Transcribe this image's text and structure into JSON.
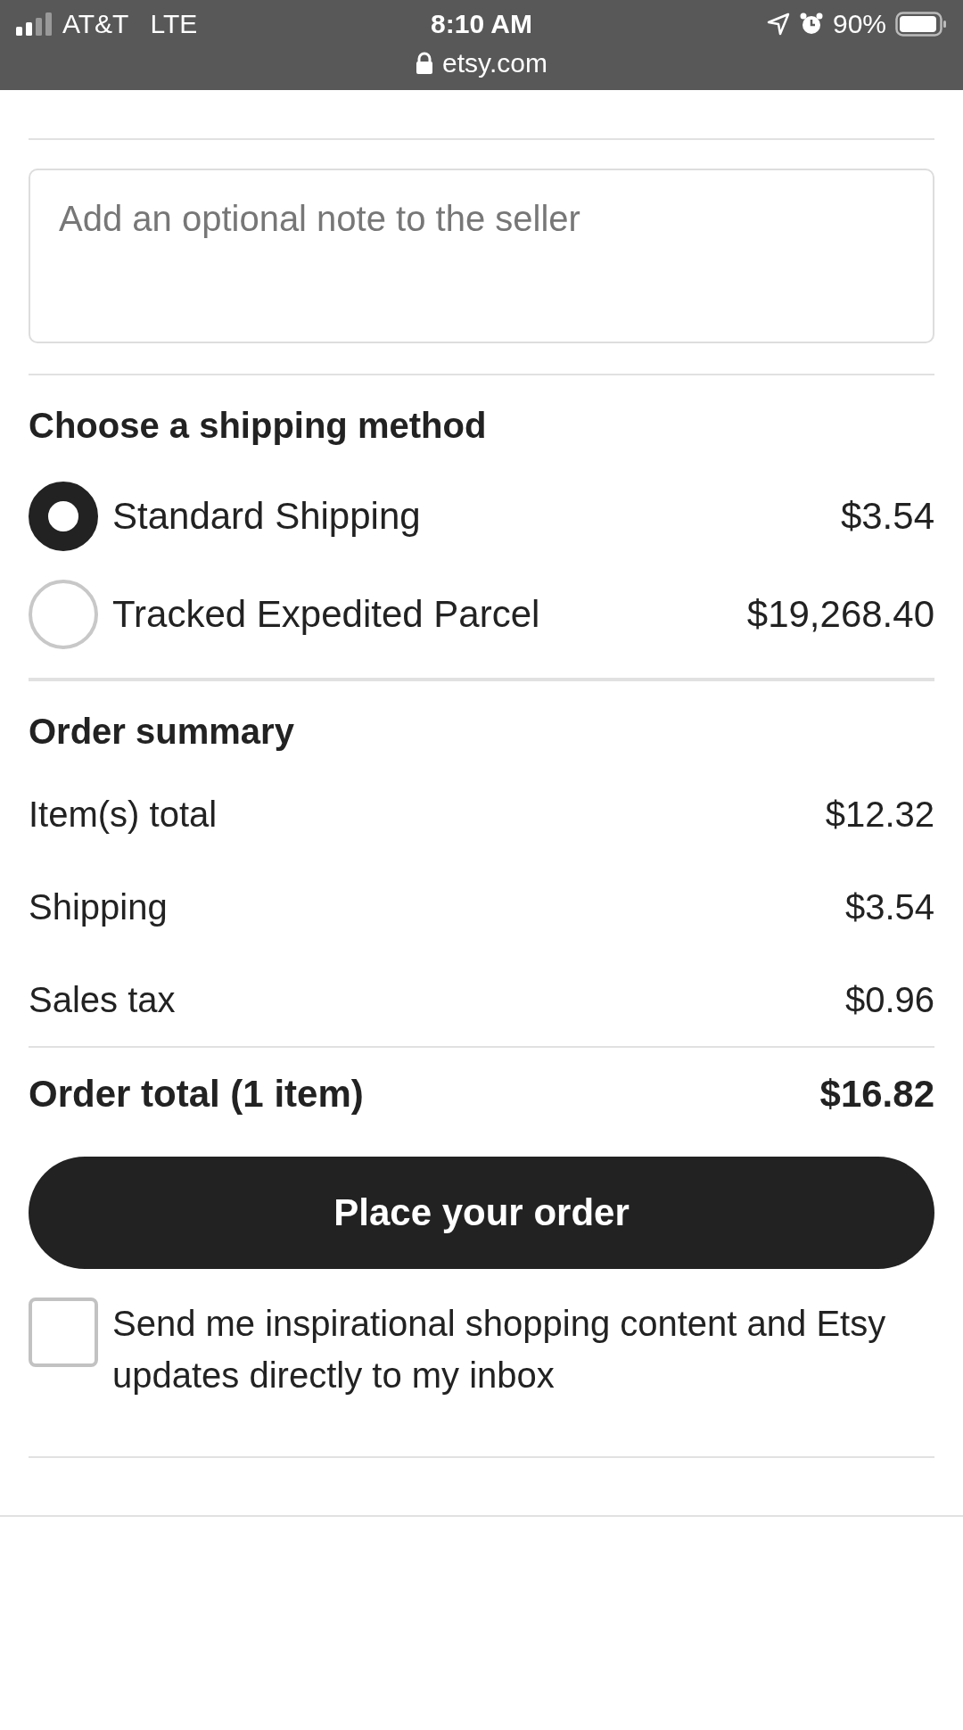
{
  "status_bar": {
    "carrier": "AT&T",
    "network": "LTE",
    "time": "8:10 AM",
    "battery": "90%",
    "url": "etsy.com"
  },
  "note": {
    "placeholder": "Add an optional note to the seller"
  },
  "shipping": {
    "title": "Choose a shipping method",
    "options": [
      {
        "label": "Standard Shipping",
        "price": "$3.54",
        "selected": true
      },
      {
        "label": "Tracked Expedited Parcel",
        "price": "$19,268.40",
        "selected": false
      }
    ]
  },
  "summary": {
    "title": "Order summary",
    "rows": [
      {
        "label": "Item(s) total",
        "value": "$12.32"
      },
      {
        "label": "Shipping",
        "value": "$3.54"
      },
      {
        "label": "Sales tax",
        "value": "$0.96"
      }
    ],
    "total": {
      "label": "Order total (1 item)",
      "value": "$16.82"
    }
  },
  "place_order_button": "Place your order",
  "newsletter": {
    "label": "Send me inspirational shopping content and Etsy updates directly to my inbox",
    "checked": false
  }
}
